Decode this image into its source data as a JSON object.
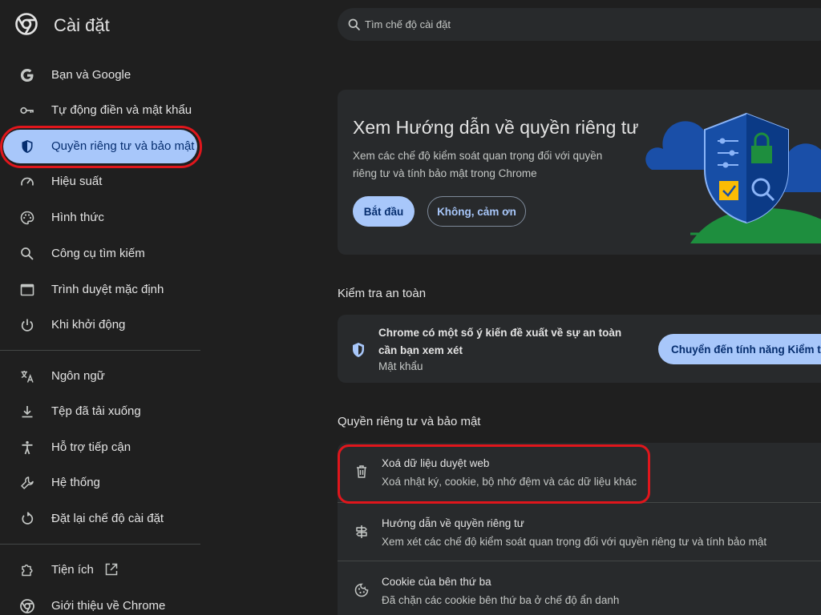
{
  "app": {
    "title": "Cài đặt",
    "logo_icon": "chrome-logo-icon"
  },
  "search": {
    "placeholder": "Tìm chế độ cài đặt"
  },
  "sidebar": {
    "items": [
      {
        "label": "Bạn và Google",
        "icon": "google-g-icon"
      },
      {
        "label": "Tự động điền và mật khẩu",
        "icon": "key-icon"
      },
      {
        "label": "Quyền riêng tư và bảo mật",
        "icon": "shield-icon",
        "active": true
      },
      {
        "label": "Hiệu suất",
        "icon": "speedometer-icon"
      },
      {
        "label": "Hình thức",
        "icon": "palette-icon"
      },
      {
        "label": "Công cụ tìm kiếm",
        "icon": "search-icon"
      },
      {
        "label": "Trình duyệt mặc định",
        "icon": "browser-window-icon"
      },
      {
        "label": "Khi khởi động",
        "icon": "power-icon"
      }
    ],
    "items2": [
      {
        "label": "Ngôn ngữ",
        "icon": "translate-icon"
      },
      {
        "label": "Tệp đã tải xuống",
        "icon": "download-icon"
      },
      {
        "label": "Hỗ trợ tiếp cận",
        "icon": "accessibility-icon"
      },
      {
        "label": "Hệ thống",
        "icon": "wrench-icon"
      },
      {
        "label": "Đặt lại chế độ cài đặt",
        "icon": "reset-icon"
      }
    ],
    "items3": [
      {
        "label": "Tiện ích",
        "icon": "extension-icon",
        "trailing_icon": "open-external-icon"
      },
      {
        "label": "Giới thiệu về Chrome",
        "icon": "chrome-logo-icon"
      }
    ]
  },
  "guide": {
    "title": "Xem Hướng dẫn về quyền riêng tư",
    "description": "Xem các chế độ kiểm soát quan trọng đối với quyền riêng tư và tính bảo mật trong Chrome",
    "start_label": "Bắt đầu",
    "dismiss_label": "Không, cảm ơn"
  },
  "safety": {
    "heading": "Kiểm tra an toàn",
    "title": "Chrome có một số ý kiến đề xuất về sự an toàn cần bạn xem xét",
    "subtitle": "Mật khẩu",
    "button_label": "Chuyển đến tính năng Kiểm tra an toàn"
  },
  "privacy": {
    "heading": "Quyền riêng tư và bảo mật",
    "rows": [
      {
        "title": "Xoá dữ liệu duyệt web",
        "subtitle": "Xoá nhật ký, cookie, bộ nhớ đệm và các dữ liệu khác",
        "icon": "trash-icon"
      },
      {
        "title": "Hướng dẫn về quyền riêng tư",
        "subtitle": "Xem xét các chế độ kiểm soát quan trọng đối với quyền riêng tư và tính bảo mật",
        "icon": "signpost-icon"
      },
      {
        "title": "Cookie của bên thứ ba",
        "subtitle": "Đã chặn các cookie bên thứ ba ở chế độ ẩn danh",
        "icon": "cookie-icon"
      }
    ]
  },
  "colors": {
    "background": "#1f1f1f",
    "card": "#282a2c",
    "accent": "#a8c7fa",
    "highlight_outline": "#e0161c"
  }
}
